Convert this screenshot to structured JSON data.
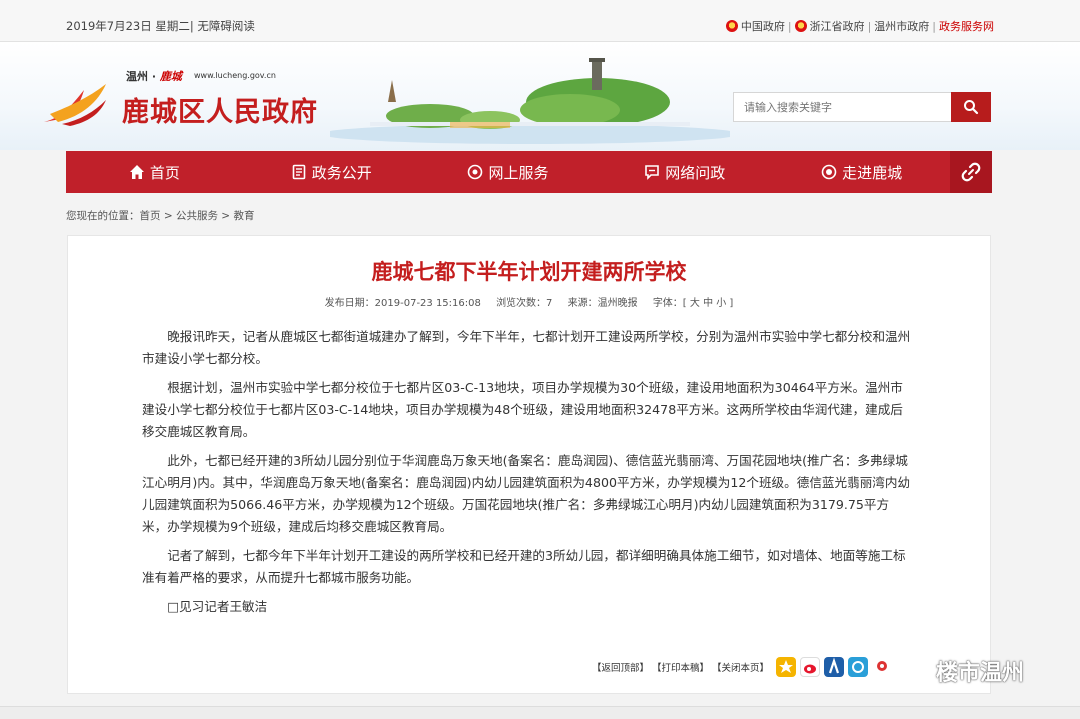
{
  "topbar": {
    "date": "2019年7月23日 星期二| 无障碍阅读",
    "links": [
      "中国政府",
      "浙江省政府",
      "温州市政府"
    ],
    "service": "政务服务网"
  },
  "header": {
    "site_small": "温州 · ",
    "site_brand": "鹿城",
    "site_url": "www.lucheng.gov.cn",
    "site_title": "鹿城区人民政府"
  },
  "search": {
    "placeholder": "请输入搜索关键字"
  },
  "nav": {
    "items": [
      "首页",
      "政务公开",
      "网上服务",
      "网络问政",
      "走进鹿城"
    ]
  },
  "breadcrumb": "您现在的位置：首页 > 公共服务 > 教育",
  "article": {
    "title": "鹿城七都下半年计划开建两所学校",
    "publish": "发布日期：2019-07-23 15:16:08",
    "views": "浏览次数：7",
    "source": "来源：温州晚报",
    "fontsize": "字体：[ 大 中 小 ]",
    "paragraphs": [
      "晚报讯昨天，记者从鹿城区七都街道城建办了解到，今年下半年，七都计划开工建设两所学校，分别为温州市实验中学七都分校和温州市建设小学七都分校。",
      "根据计划，温州市实验中学七都分校位于七都片区03-C-13地块，项目办学规模为30个班级，建设用地面积为30464平方米。温州市建设小学七都分校位于七都片区03-C-14地块，项目办学规模为48个班级，建设用地面积32478平方米。这两所学校由华润代建，建成后移交鹿城区教育局。",
      "此外，七都已经开建的3所幼儿园分别位于华润鹿岛万象天地(备案名：鹿岛润园)、德信蓝光翡丽湾、万国花园地块(推广名：多弗绿城江心明月)内。其中，华润鹿岛万象天地(备案名：鹿岛润园)内幼儿园建筑面积为4800平方米，办学规模为12个班级。德信蓝光翡丽湾内幼儿园建筑面积为5066.46平方米，办学规模为12个班级。万国花园地块(推广名：多弗绿城江心明月)内幼儿园建筑面积为3179.75平方米，办学规模为9个班级，建成后均移交鹿城区教育局。",
      "记者了解到，七都今年下半年计划开工建设的两所学校和已经开建的3所幼儿园，都详细明确具体施工细节，如对墙体、地面等施工标准有着严格的要求，从而提升七都城市服务功能。"
    ],
    "signature": "□见习记者王敏洁"
  },
  "tools": [
    "【返回顶部】",
    "【打印本稿】",
    "【关闭本页】"
  ],
  "watermark": "楼市温州",
  "colors": {
    "brand_red": "#c0202a",
    "title_red": "#c41e1e"
  }
}
